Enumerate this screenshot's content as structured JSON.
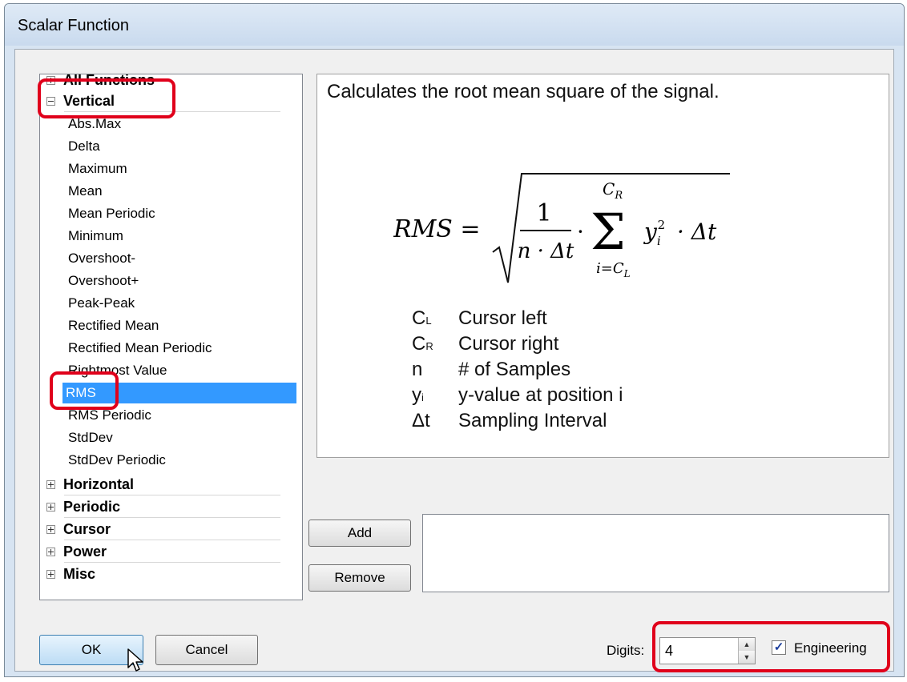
{
  "window": {
    "title": "Scalar Function"
  },
  "tree": {
    "groups": [
      {
        "label": "All Functions",
        "expanded": false
      },
      {
        "label": "Vertical",
        "expanded": true
      },
      {
        "label": "Horizontal",
        "expanded": false
      },
      {
        "label": "Periodic",
        "expanded": false
      },
      {
        "label": "Cursor",
        "expanded": false
      },
      {
        "label": "Power",
        "expanded": false
      },
      {
        "label": "Misc",
        "expanded": false
      }
    ],
    "vertical_items": [
      "Abs.Max",
      "Delta",
      "Maximum",
      "Mean",
      "Mean Periodic",
      "Minimum",
      "Overshoot-",
      "Overshoot+",
      "Peak-Peak",
      "Rectified Mean",
      "Rectified Mean Periodic",
      "Rightmost Value",
      "RMS",
      "RMS Periodic",
      "StdDev",
      "StdDev Periodic"
    ],
    "selected": "RMS"
  },
  "description": {
    "text": "Calculates the root mean square of the signal.",
    "formula": {
      "lhs": "RMS =",
      "numerator": "1",
      "denominator": "n · Δt",
      "dot": "·",
      "sum_upper": "C",
      "sum_upper_sub": "R",
      "sum_lower": "i=C",
      "sum_lower_sub": "L",
      "summand": "y",
      "summand_sub": "i",
      "summand_sup": "2",
      "tail": "· Δt"
    },
    "legend": [
      {
        "sym": "C",
        "sub": "L",
        "text": "Cursor left"
      },
      {
        "sym": "C",
        "sub": "R",
        "text": "Cursor right"
      },
      {
        "sym": "n",
        "sub": "",
        "text": "# of Samples"
      },
      {
        "sym": "y",
        "sub": "i",
        "text": "y-value at position i"
      },
      {
        "sym": "Δt",
        "sub": "",
        "text": "Sampling Interval"
      }
    ]
  },
  "buttons": {
    "add": "Add",
    "remove": "Remove",
    "ok": "OK",
    "cancel": "Cancel"
  },
  "digits": {
    "label": "Digits:",
    "value": "4"
  },
  "engineering": {
    "label": "Engineering",
    "checked": true,
    "mark": "✓"
  },
  "colors": {
    "selection": "#3399ff",
    "highlight": "#e0001b"
  }
}
